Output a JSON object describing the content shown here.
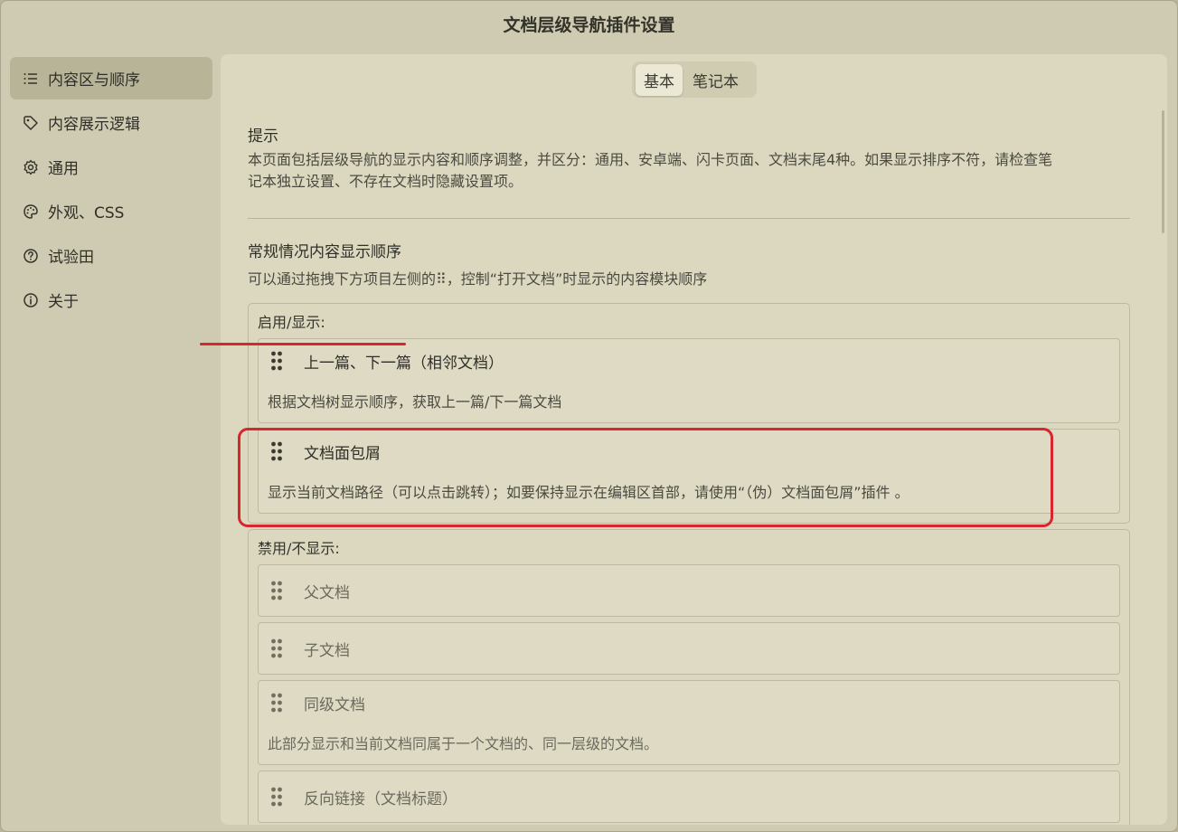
{
  "window": {
    "title": "文档层级导航插件设置"
  },
  "sidebar": {
    "items": [
      {
        "label": "内容区与顺序",
        "icon": "list-icon",
        "active": true
      },
      {
        "label": "内容展示逻辑",
        "icon": "tag-icon",
        "active": false
      },
      {
        "label": "通用",
        "icon": "gear-icon",
        "active": false
      },
      {
        "label": "外观、CSS",
        "icon": "palette-icon",
        "active": false
      },
      {
        "label": "试验田",
        "icon": "help-circle-icon",
        "active": false
      },
      {
        "label": "关于",
        "icon": "info-icon",
        "active": false
      }
    ]
  },
  "tabs": [
    {
      "label": "基本",
      "active": true
    },
    {
      "label": "笔记本",
      "active": false
    }
  ],
  "hint": {
    "title": "提示",
    "desc_line1": "本页面包括层级导航的显示内容和顺序调整，并区分：通用、安卓端、闪卡页面、文档末尾4种。如果显示排序不符，请检查笔",
    "desc_line2": "记本独立设置、不存在文档时隐藏设置项。"
  },
  "order": {
    "title": "常规情况内容显示顺序",
    "desc": "可以通过拖拽下方项目左侧的⠿，控制“打开文档”时显示的内容模块顺序"
  },
  "enabled": {
    "label": "启用/显示:",
    "items": [
      {
        "title": "上一篇、下一篇（相邻文档）",
        "desc": "根据文档树显示顺序，获取上一篇/下一篇文档"
      },
      {
        "title": "文档面包屑",
        "desc": "显示当前文档路径（可以点击跳转）；如要保持显示在编辑区首部，请使用“（伪）文档面包屑”插件 。"
      }
    ]
  },
  "disabled": {
    "label": "禁用/不显示:",
    "items": [
      {
        "title": "父文档"
      },
      {
        "title": "子文档"
      },
      {
        "title": "同级文档",
        "desc": "此部分显示和当前文档同属于一个文档的、同一层级的文档。"
      },
      {
        "title": "反向链接（文档标题）"
      }
    ]
  },
  "colors": {
    "annotation": "#d7262d",
    "panel": "#dcd8c0",
    "window": "#cfcbb2"
  }
}
